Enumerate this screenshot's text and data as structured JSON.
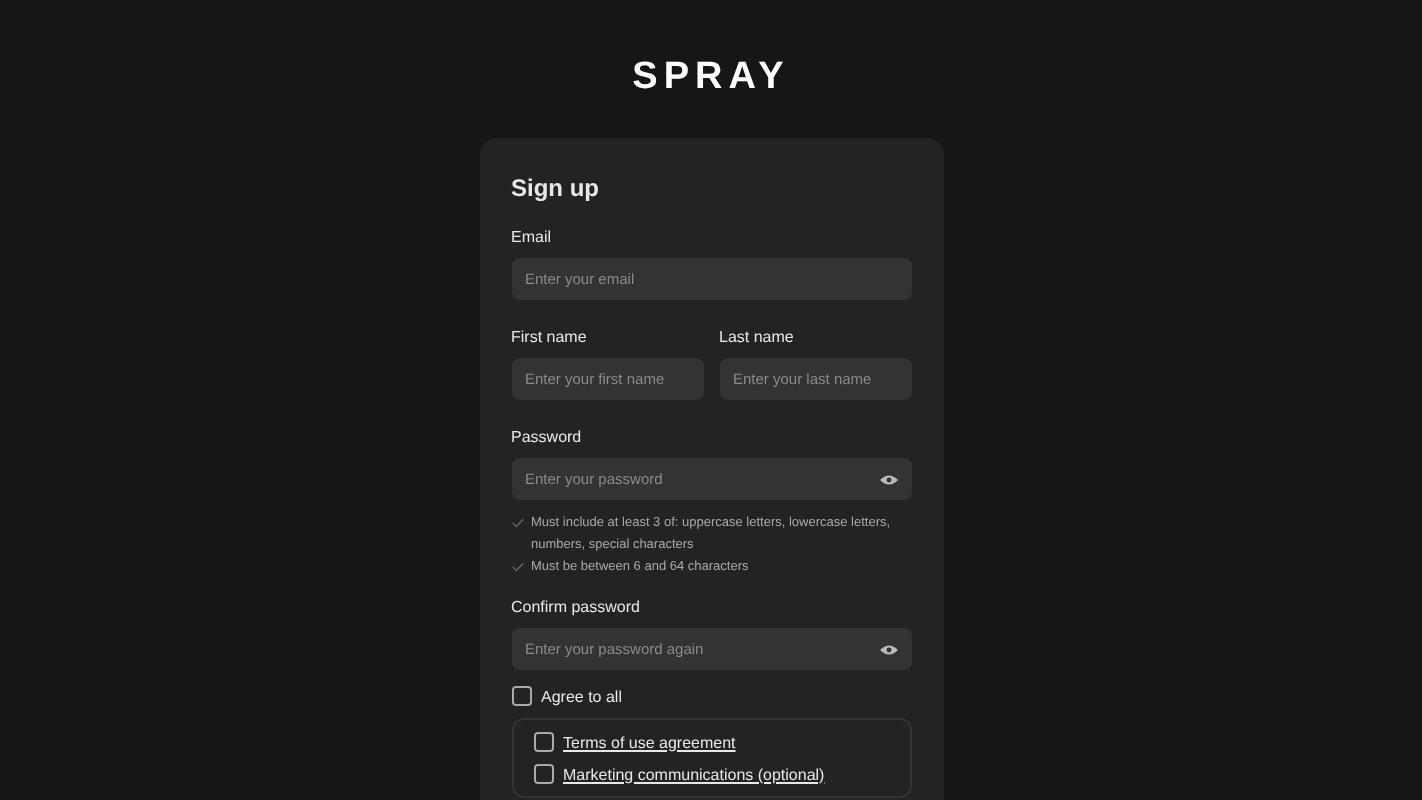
{
  "logo": "SPRAY",
  "form": {
    "title": "Sign up",
    "email": {
      "label": "Email",
      "placeholder": "Enter your email"
    },
    "first_name": {
      "label": "First name",
      "placeholder": "Enter your first name"
    },
    "last_name": {
      "label": "Last name",
      "placeholder": "Enter your last name"
    },
    "password": {
      "label": "Password",
      "placeholder": "Enter your password"
    },
    "password_hints": [
      {
        "text": "Must include at least 3 of: uppercase letters, lowercase letters, numbers, special characters",
        "met": false
      },
      {
        "text": "Must be between 6 and 64 characters",
        "met": false
      }
    ],
    "confirm_password": {
      "label": "Confirm password",
      "placeholder": "Enter your password again"
    },
    "agree_all": {
      "label": "Agree to all",
      "checked": false
    },
    "agreements": [
      {
        "label": "Terms of use agreement",
        "checked": false
      },
      {
        "label": "Marketing communications (optional)",
        "checked": false
      }
    ]
  }
}
